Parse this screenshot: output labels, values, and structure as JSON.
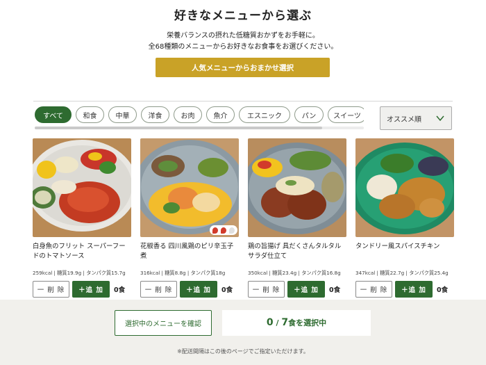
{
  "header": {
    "title": "好きなメニューから選ぶ",
    "desc_line1": "栄養バランスの摂れた低糖質おかずをお手軽に。",
    "desc_line2": "全68種類のメニューからお好きなお食事をお選びください。",
    "omakase_label": "人気メニューからおまかせ選択"
  },
  "categories": [
    {
      "label": "すべて",
      "active": true
    },
    {
      "label": "和食",
      "active": false
    },
    {
      "label": "中華",
      "active": false
    },
    {
      "label": "洋食",
      "active": false
    },
    {
      "label": "お肉",
      "active": false
    },
    {
      "label": "魚介",
      "active": false
    },
    {
      "label": "エスニック",
      "active": false
    },
    {
      "label": "パン",
      "active": false
    },
    {
      "label": "スイーツ",
      "active": false
    }
  ],
  "sort": {
    "selected": "オススメ順",
    "icon": "chevron-down-icon"
  },
  "products": [
    {
      "name": "白身魚のフリット スーパーフードのトマトソース",
      "kcal": "259kcal",
      "carb": "糖質19.9g",
      "protein": "タンパク質15.7g",
      "qty": "0",
      "spicy": false
    },
    {
      "name": "花椒香る 四川風鶏のピリ辛玉子煮",
      "kcal": "316kcal",
      "carb": "糖質8.8g",
      "protein": "タンパク質18g",
      "qty": "0",
      "spicy": true
    },
    {
      "name": "鶏の旨揚げ 具だくさんタルタルサラダ仕立て",
      "kcal": "350kcal",
      "carb": "糖質23.4g",
      "protein": "タンパク質16.8g",
      "qty": "0",
      "spicy": false
    },
    {
      "name": "タンドリー風スパイスチキン",
      "kcal": "347kcal",
      "carb": "糖質22.7g",
      "protein": "タンパク質25.4g",
      "qty": "0",
      "spicy": false
    }
  ],
  "buttons": {
    "delete": "一 削 除",
    "add": "＋追 加",
    "unit": "食"
  },
  "footer": {
    "confirm_label": "選択中のメニューを確認",
    "count_selected": "0",
    "count_sep": " / ",
    "count_total": "7",
    "count_suffix": "食を選択中",
    "note": "※配送間隔はこの後のページでご指定いただけます。"
  },
  "colors": {
    "brand_green": "#2e6b30",
    "gold": "#c9a227",
    "footer_bg": "#f1f0ec"
  }
}
